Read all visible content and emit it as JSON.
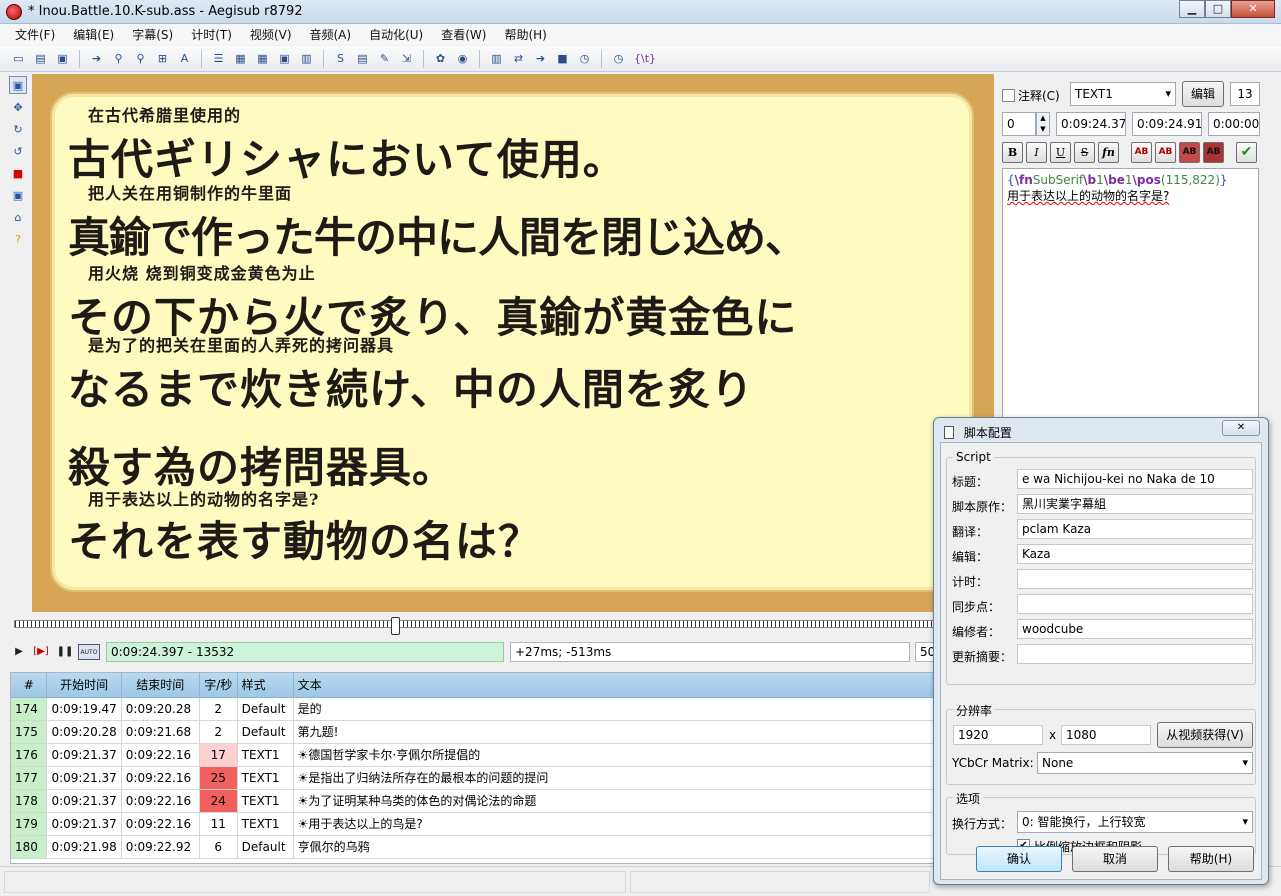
{
  "window": {
    "title": "* Inou.Battle.10.K-sub.ass - Aegisub r8792",
    "minimize": "▁",
    "maximize": "□",
    "close": "✕"
  },
  "menu": [
    "文件(F)",
    "编辑(E)",
    "字幕(S)",
    "计时(T)",
    "视频(V)",
    "音频(A)",
    "自动化(U)",
    "查看(W)",
    "帮助(H)"
  ],
  "toolbar": {
    "icons": [
      "new-file-icon",
      "open-file-icon",
      "save-icon",
      "jump-icon",
      "find-icon",
      "find-replace-icon",
      "attachments-icon",
      "fonts-collector-icon",
      "styles-manager-icon",
      "properties-icon",
      "video-details-icon",
      "export-icon",
      "keyframes-icon",
      "shift-times-icon",
      "timing-post-processor-icon",
      "translation-assistant-icon",
      "resample-icon",
      "spell-check-icon",
      "assistant-icon",
      "kanji-timer-icon",
      "video-sync-icon",
      "tags-icon",
      "options-icon",
      "hotkeys-icon",
      "override-tags-icon"
    ],
    "glyphs": [
      "▭",
      "▤",
      "▣",
      "➔",
      "⚲",
      "⚲",
      "⊞",
      "A",
      "☰",
      "▦",
      "▦",
      "▣",
      "▥",
      "S",
      "▤",
      "✎",
      "⇲",
      "✿",
      "◉",
      "▥",
      "⇄",
      "➔",
      "■",
      "◷",
      "{\\t}"
    ]
  },
  "left_tools": {
    "glyphs": [
      "▣",
      "✥",
      "↻",
      "↺",
      "■",
      "▣",
      "⌂",
      "?"
    ]
  },
  "video": {
    "lines": [
      {
        "zh": "在古代希腊里使用的",
        "ja": "古代ギリシャにおいて使用。"
      },
      {
        "zh": "把人关在用铜制作的牛里面",
        "ja": "真鍮で作った牛の中に人間を閉じ込め、"
      },
      {
        "zh": "用火烧 烧到铜变成金黄色为止",
        "ja": "その下から火で炙り、真鍮が黄金色に"
      },
      {
        "zh": "是为了的把关在里面的人弄死的拷问器具",
        "ja": "なるまで炊き続け、中の人間を炙り"
      },
      {
        "zh": "",
        "ja": "殺す為の拷問器具。"
      },
      {
        "zh": "用于表达以上的动物的名字是?",
        "ja": "それを表す動物の名は？"
      }
    ]
  },
  "playback": {
    "controls": [
      "▶",
      "[▶]",
      "❚❚",
      "AUTO"
    ],
    "time": "0:09:24.397 - 13532",
    "offset": "+27ms; -513ms",
    "zoom": "50"
  },
  "grid": {
    "headers": [
      "#",
      "开始时间",
      "结束时间",
      "字/秒",
      "样式",
      "文本"
    ],
    "rows": [
      {
        "n": "174",
        "start": "0:09:19.47",
        "end": "0:09:20.28",
        "cps": "2",
        "style": "Default",
        "text": "是的",
        "warn": 0
      },
      {
        "n": "175",
        "start": "0:09:20.28",
        "end": "0:09:21.68",
        "cps": "2",
        "style": "Default",
        "text": "第九题!",
        "warn": 0
      },
      {
        "n": "176",
        "start": "0:09:21.37",
        "end": "0:09:22.16",
        "cps": "17",
        "style": "TEXT1",
        "text": "☀德国哲学家卡尔·亨佩尔所提倡的",
        "warn": 1
      },
      {
        "n": "177",
        "start": "0:09:21.37",
        "end": "0:09:22.16",
        "cps": "25",
        "style": "TEXT1",
        "text": "☀是指出了归纳法所存在的最根本的问题的提问",
        "warn": 2
      },
      {
        "n": "178",
        "start": "0:09:21.37",
        "end": "0:09:22.16",
        "cps": "24",
        "style": "TEXT1",
        "text": "☀为了证明某种乌类的体色的对偶论法的命题",
        "warn": 2
      },
      {
        "n": "179",
        "start": "0:09:21.37",
        "end": "0:09:22.16",
        "cps": "11",
        "style": "TEXT1",
        "text": "☀用于表达以上的鸟是?",
        "warn": 0
      },
      {
        "n": "180",
        "start": "0:09:21.98",
        "end": "0:09:22.92",
        "cps": "6",
        "style": "Default",
        "text": "亨佩尔的乌鸦",
        "warn": 0
      }
    ]
  },
  "edit": {
    "comment_label": "注释(C)",
    "style": "TEXT1",
    "edit_button": "编辑",
    "layer": "13",
    "margin_l": "0",
    "start_time": "0:09:24.37",
    "end_time": "0:09:24.91",
    "duration": "0:00:00.",
    "format_buttons": [
      "B",
      "I",
      "U",
      "S",
      "fn",
      "AB",
      "AB",
      "AB",
      "AB",
      "✔"
    ],
    "tags": {
      "open": "{",
      "fn_tag": "\\fn",
      "fn_val": "SubSerif",
      "b_tag": "\\b",
      "b_val": "1",
      "be_tag": "\\be",
      "be_val": "1",
      "pos_tag": "\\pos",
      "pos_val": "(115,822)",
      "close": "}"
    },
    "text": "用于表达以上的动物的名字是?"
  },
  "dialog": {
    "title": "脚本配置",
    "close": "✕",
    "script_group": "Script",
    "fields": [
      {
        "label": "标题：",
        "value": "e wa Nichijou-kei no Naka de 10"
      },
      {
        "label": "脚本原作：",
        "value": "黑川実業字幕組"
      },
      {
        "label": "翻译：",
        "value": "pclam  Kaza"
      },
      {
        "label": "编辑：",
        "value": "Kaza"
      },
      {
        "label": "计时：",
        "value": ""
      },
      {
        "label": "同步点：",
        "value": ""
      },
      {
        "label": "编修者：",
        "value": "woodcube"
      },
      {
        "label": "更新摘要：",
        "value": ""
      }
    ],
    "res_group": "分辨率",
    "res_w": "1920",
    "res_x": "x",
    "res_h": "1080",
    "from_video": "从视频获得(V)",
    "ycbcr_label": "YCbCr Matrix:",
    "ycbcr_value": "None",
    "options_group": "选项",
    "wrap_label": "换行方式：",
    "wrap_value": "0: 智能换行，上行较宽",
    "scale_label": "比例缩放边框和阴影",
    "ok": "确认",
    "cancel": "取消",
    "help": "帮助(H)"
  }
}
